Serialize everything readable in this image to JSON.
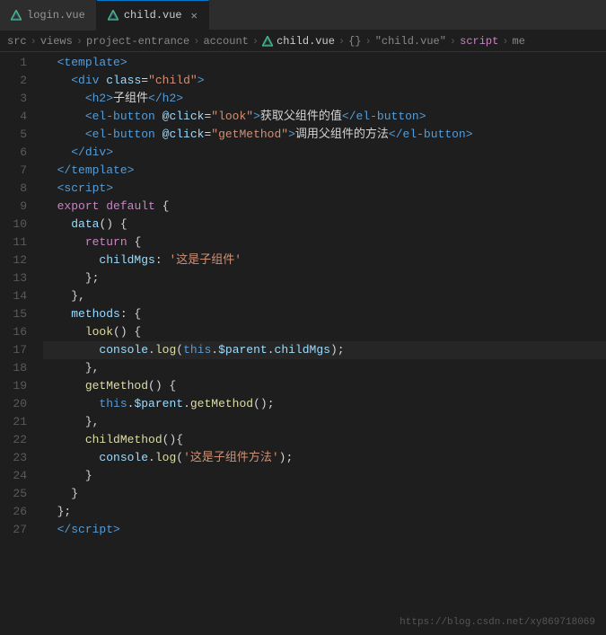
{
  "tabs": [
    {
      "id": "login",
      "label": "login.vue",
      "active": false,
      "closeable": false
    },
    {
      "id": "child",
      "label": "child.vue",
      "active": true,
      "closeable": true
    }
  ],
  "breadcrumb": {
    "parts": [
      "src",
      "views",
      "project-entrance",
      "account",
      "child.vue",
      "{}",
      "\"child.vue\"",
      "script",
      "me"
    ]
  },
  "editor": {
    "lines": [
      {
        "no": 1,
        "code_html": "  <span class='tag'>&lt;template&gt;</span>"
      },
      {
        "no": 2,
        "code_html": "    <span class='tag'>&lt;div</span> <span class='attr'>class</span><span class='white'>=</span><span class='attr-val'>\"child\"</span><span class='tag'>&gt;</span>"
      },
      {
        "no": 3,
        "code_html": "      <span class='tag'>&lt;h2&gt;</span><span class='white'>子组件</span><span class='tag'>&lt;/h2&gt;</span>"
      },
      {
        "no": 4,
        "code_html": "      <span class='tag'>&lt;el-button</span> <span class='attr'>@click</span><span class='white'>=</span><span class='attr-val'>\"look\"</span><span class='tag'>&gt;</span><span class='white'>获取父组件的值</span><span class='tag'>&lt;/el-button&gt;</span>"
      },
      {
        "no": 5,
        "code_html": "      <span class='tag'>&lt;el-button</span> <span class='attr'>@click</span><span class='white'>=</span><span class='attr-val'>\"getMethod\"</span><span class='tag'>&gt;</span><span class='white'>调用父组件的方法</span><span class='tag'>&lt;/el-button&gt;</span>"
      },
      {
        "no": 6,
        "code_html": "    <span class='tag'>&lt;/div&gt;</span>"
      },
      {
        "no": 7,
        "code_html": "  <span class='tag'>&lt;/template&gt;</span>"
      },
      {
        "no": 8,
        "code_html": "  <span class='tag'>&lt;script&gt;</span>"
      },
      {
        "no": 9,
        "code_html": "  <span class='pink'>export</span> <span class='pink'>default</span> <span class='white'>{</span>"
      },
      {
        "no": 10,
        "code_html": "    <span class='lt-blue'>data</span><span class='white'>() {</span>"
      },
      {
        "no": 11,
        "code_html": "      <span class='pink'>return</span> <span class='white'>{</span>"
      },
      {
        "no": 12,
        "code_html": "        <span class='lt-blue'>childMgs</span><span class='white'>: </span><span class='orange'>'这是子组件'</span>"
      },
      {
        "no": 13,
        "code_html": "      <span class='white'>};</span>"
      },
      {
        "no": 14,
        "code_html": "    <span class='white'>},</span>"
      },
      {
        "no": 15,
        "code_html": "    <span class='lt-blue'>methods</span><span class='white'>: {</span>"
      },
      {
        "no": 16,
        "code_html": "      <span class='yellow'>look</span><span class='white'>() {</span>"
      },
      {
        "no": 17,
        "code_html": "        <span class='lt-blue'>console</span><span class='white'>.</span><span class='yellow'>log</span><span class='white'>(</span><span class='kw2'>this</span><span class='white'>.</span><span class='lt-blue'>$parent</span><span class='white'>.</span><span class='lt-blue'>childMgs</span><span class='white'>);</span>",
        "cursor": true
      },
      {
        "no": 18,
        "code_html": "      <span class='white'>},</span>"
      },
      {
        "no": 19,
        "code_html": "      <span class='yellow'>getMethod</span><span class='white'>() {</span>"
      },
      {
        "no": 20,
        "code_html": "        <span class='kw2'>this</span><span class='white'>.</span><span class='lt-blue'>$parent</span><span class='white'>.</span><span class='yellow'>getMethod</span><span class='white'>();</span>"
      },
      {
        "no": 21,
        "code_html": "      <span class='white'>},</span>"
      },
      {
        "no": 22,
        "code_html": "      <span class='yellow'>childMethod</span><span class='white'>(){</span>"
      },
      {
        "no": 23,
        "code_html": "        <span class='lt-blue'>console</span><span class='white'>.</span><span class='yellow'>log</span><span class='white'>(</span><span class='orange'>'这是子组件方法'</span><span class='white'>);</span>"
      },
      {
        "no": 24,
        "code_html": "      <span class='white'>}</span>"
      },
      {
        "no": 25,
        "code_html": "    <span class='white'>}</span>"
      },
      {
        "no": 26,
        "code_html": "  <span class='white'>};</span>"
      },
      {
        "no": 27,
        "code_html": "  <span class='tag'>&lt;/script&gt;</span>"
      }
    ]
  },
  "watermark": "https://blog.csdn.net/xy869718069"
}
